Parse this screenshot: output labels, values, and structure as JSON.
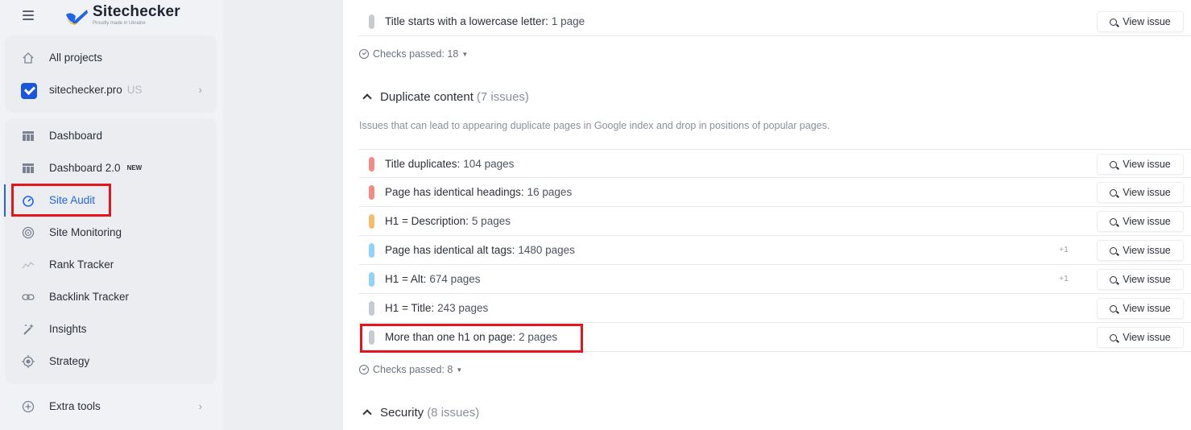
{
  "brand": {
    "name": "Sitechecker",
    "tagline": "Proudly made in Ukraine"
  },
  "sidebar": {
    "all_projects": "All projects",
    "project": {
      "name": "sitechecker.pro",
      "region": "US"
    },
    "items": [
      {
        "label": "Dashboard",
        "icon": "grid-icon"
      },
      {
        "label": "Dashboard 2.0",
        "tag": "NEW",
        "icon": "grid-icon"
      },
      {
        "label": "Site Audit",
        "icon": "gauge-icon"
      },
      {
        "label": "Site Monitoring",
        "icon": "radar-icon"
      },
      {
        "label": "Rank Tracker",
        "icon": "trend-icon"
      },
      {
        "label": "Backlink Tracker",
        "icon": "link-icon"
      },
      {
        "label": "Insights",
        "icon": "magic-wand-icon"
      },
      {
        "label": "Strategy",
        "icon": "target-icon"
      }
    ],
    "extra_tools": "Extra tools"
  },
  "main": {
    "top_row": {
      "title": "Title starts with a lowercase letter:",
      "count": "1 page",
      "color": "#c6cad1"
    },
    "checks_passed_1": "Checks passed: 18",
    "section": {
      "title": "Duplicate content",
      "issues": "(7 issues)",
      "description": "Issues that can lead to appearing duplicate pages in Google index and drop in positions of popular pages."
    },
    "rows": [
      {
        "title": "Title duplicates:",
        "count": "104 pages",
        "color": "#f28b82",
        "extra": ""
      },
      {
        "title": "Page has identical headings:",
        "count": "16 pages",
        "color": "#f28b82",
        "extra": ""
      },
      {
        "title": "H1 = Description:",
        "count": "5 pages",
        "color": "#f7bb6b",
        "extra": ""
      },
      {
        "title": "Page has identical alt tags:",
        "count": "1480 pages",
        "color": "#8fd3f7",
        "extra": "+1"
      },
      {
        "title": "H1 = Alt:",
        "count": "674 pages",
        "color": "#8fd3f7",
        "extra": "+1"
      },
      {
        "title": "H1 = Title:",
        "count": "243 pages",
        "color": "#c6cad1",
        "extra": ""
      },
      {
        "title": "More than one h1 on page:",
        "count": "2 pages",
        "color": "#c6cad1",
        "extra": ""
      }
    ],
    "view_issue_label": "View issue",
    "checks_passed_2": "Checks passed: 8",
    "security": {
      "title": "Security",
      "issues": "(8 issues)"
    }
  }
}
